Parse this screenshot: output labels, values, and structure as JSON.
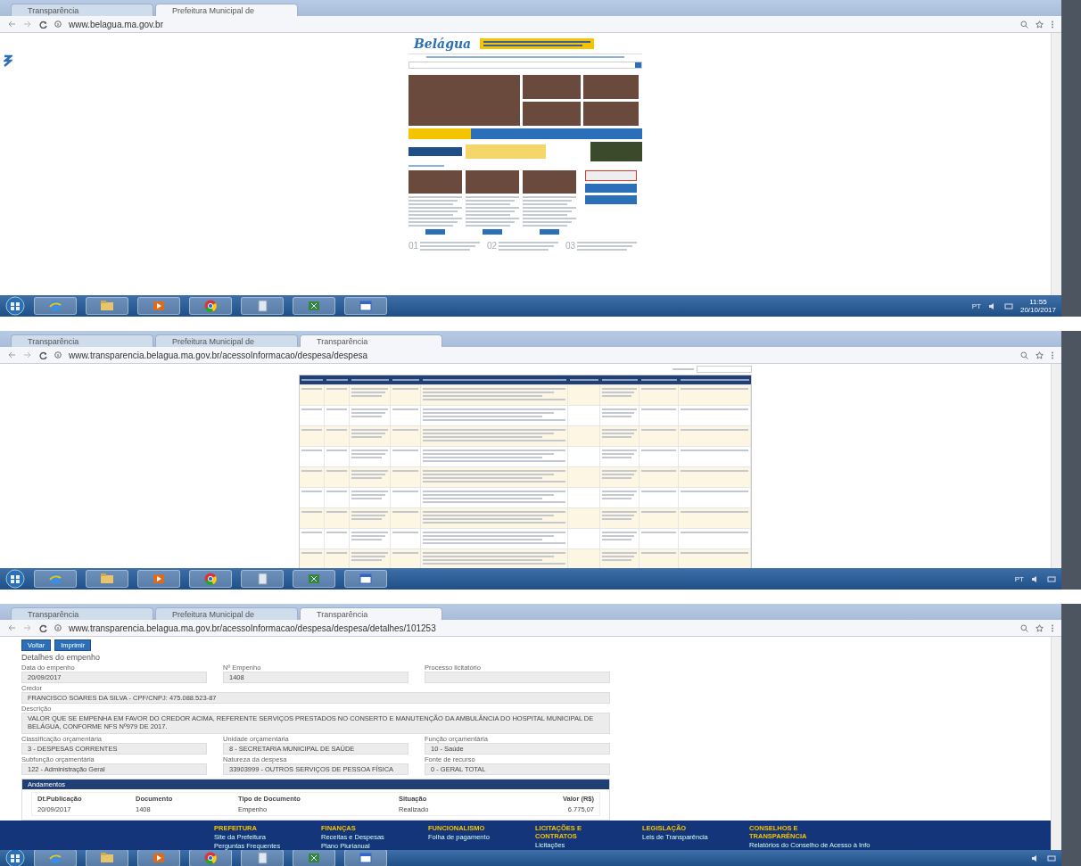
{
  "screens": [
    {
      "kind": "home",
      "tabs": [
        {
          "label": "Transparência",
          "selected": false
        },
        {
          "label": "Prefeitura Municipal de",
          "selected": true
        }
      ],
      "url": "www.belagua.ma.gov.br",
      "logo": "Belágua",
      "numbers": [
        "01",
        "02",
        "03"
      ],
      "taskbar": {
        "lang": "PT",
        "time": "11:55",
        "date": "20/10/2017"
      }
    },
    {
      "kind": "table",
      "tabs": [
        {
          "label": "Transparência",
          "selected": false
        },
        {
          "label": "Prefeitura Municipal de",
          "selected": false
        },
        {
          "label": "Transparência",
          "selected": true
        }
      ],
      "url": "www.transparencia.belagua.ma.gov.br/acessoInformacao/despesa/despesa",
      "taskbar": {
        "lang": "PT"
      }
    },
    {
      "kind": "detail",
      "tabs": [
        {
          "label": "Transparência",
          "selected": false
        },
        {
          "label": "Prefeitura Municipal de",
          "selected": false
        },
        {
          "label": "Transparência",
          "selected": true
        }
      ],
      "url": "www.transparencia.belagua.ma.gov.br/acessoInformacao/despesa/despesa/detalhes/101253",
      "buttons": [
        "Voltar",
        "Imprimir"
      ],
      "heading": "Detalhes do empenho",
      "fields": [
        {
          "kind": "short",
          "label": "Data do empenho",
          "value": "20/09/2017"
        },
        {
          "kind": "short",
          "label": "Nº Empenho",
          "value": "1408"
        },
        {
          "kind": "short",
          "label": "Processo licitatório"
        },
        {
          "kind": "wide",
          "label": "Credor",
          "value": "FRANCISCO SOARES DA SILVA - CPF/CNPJ: 475.088.523-87"
        },
        {
          "kind": "area",
          "label": "Descrição",
          "value": "VALOR QUE SE EMPENHA EM FAVOR DO CREDOR ACIMA, REFERENTE SERVIÇOS PRESTADOS NO CONSERTO E MANUTENÇÃO DA AMBULÂNCIA DO HOSPITAL MUNICIPAL DE BELÁGUA, CONFORME NFS Nº979 DE 2017."
        },
        {
          "kind": "short",
          "label": "Classificação orçamentária",
          "value": "3 - DESPESAS CORRENTES"
        },
        {
          "kind": "short",
          "label": "Unidade orçamentária",
          "value": "8 - SECRETARIA MUNICIPAL DE SAÚDE"
        },
        {
          "kind": "short",
          "label": "Função orçamentária",
          "value": "10 - Saúde"
        },
        {
          "kind": "short",
          "label": "Subfunção orçamentária",
          "value": "122 - Administração Geral"
        },
        {
          "kind": "short",
          "label": "Natureza da despesa",
          "value": "33903999 - OUTROS SERVIÇOS DE PESSOA FÍSICA"
        },
        {
          "kind": "short",
          "label": "Fonte de recurso",
          "value": "0 - GERAL TOTAL"
        }
      ],
      "steps": {
        "title": "Andamentos",
        "columns": [
          "Dt.Publicação",
          "Documento",
          "Tipo de Documento",
          "Situação",
          "Valor (R$)"
        ],
        "rows": [
          [
            "20/09/2017",
            "1408",
            "Empenho",
            "Realizado",
            "6.775,07"
          ]
        ]
      },
      "footer": [
        {
          "title": "PREFEITURA",
          "links": [
            "Site da Prefeitura",
            "Perguntas Frequentes"
          ]
        },
        {
          "title": "FINANÇAS",
          "links": [
            "Receitas e Despesas",
            "Plano Plurianual"
          ]
        },
        {
          "title": "FUNCIONALISMO",
          "links": [
            "Folha de pagamento"
          ]
        },
        {
          "title": "LICITAÇÕES E CONTRATOS",
          "links": [
            "Licitações"
          ]
        },
        {
          "title": "LEGISLAÇÃO",
          "links": [
            "Leis de Transparência"
          ]
        },
        {
          "title": "CONSELHOS E TRANSPARÊNCIA",
          "links": [
            "Relatórios do Conselho de Acesso à Info"
          ]
        }
      ]
    }
  ]
}
